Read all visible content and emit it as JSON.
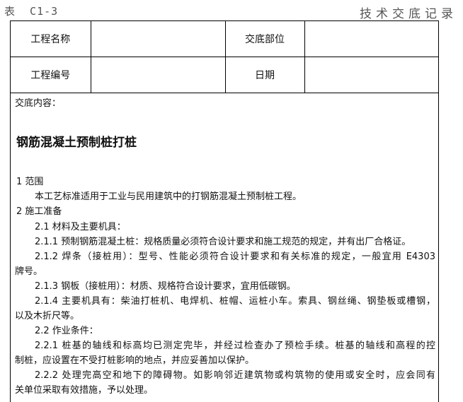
{
  "header": {
    "form_code": "表  C1-3",
    "form_title": "技术交底记录"
  },
  "info_table": {
    "project_name_label": "工程名称",
    "project_name_value": "",
    "location_label": "交底部位",
    "location_value": "",
    "project_no_label": "工程编号",
    "project_no_value": "",
    "date_label": "日期",
    "date_value": ""
  },
  "content": {
    "label": "交底内容：",
    "title": "钢筋混凝土预制桩打桩",
    "lines": [
      "1  范围",
      "本工艺标准适用于工业与民用建筑中的打钢筋混凝土预制桩工程。",
      "2  施工准备",
      "2.1  材料及主要机具：",
      "2.1.1  预制钢筋混凝土桩：规格质量必须符合设计要求和施工规范的规定，并有出厂合格证。",
      "2.1.2  焊条（接桩用）：型号、性能必须符合设计要求和有关标准的规定，一般宜用 E4303",
      "牌号。",
      "2.1.3  钢板（接桩用）：材质、规格符合设计要求，宜用低碳钢。",
      "2.1.4  主要机具有：柴油打桩机、电焊机、桩帽、运桩小车。索具、钢丝绳、钢垫板或槽钢，",
      "以及木折尺等。",
      "2.2  作业条件：",
      "2.2.1  桩基的轴线和标高均已测定完毕，并经过检查办了预检手续。桩基的轴线和高程的控",
      "制桩，应设置在不受打桩影响的地点，并应妥善加以保护。",
      "2.2.2  处理完高空和地下的障碍物。如影响邻近建筑物或构筑物的使用或安全时，应会同有",
      "关单位采取有效措施，予以处理。"
    ]
  }
}
